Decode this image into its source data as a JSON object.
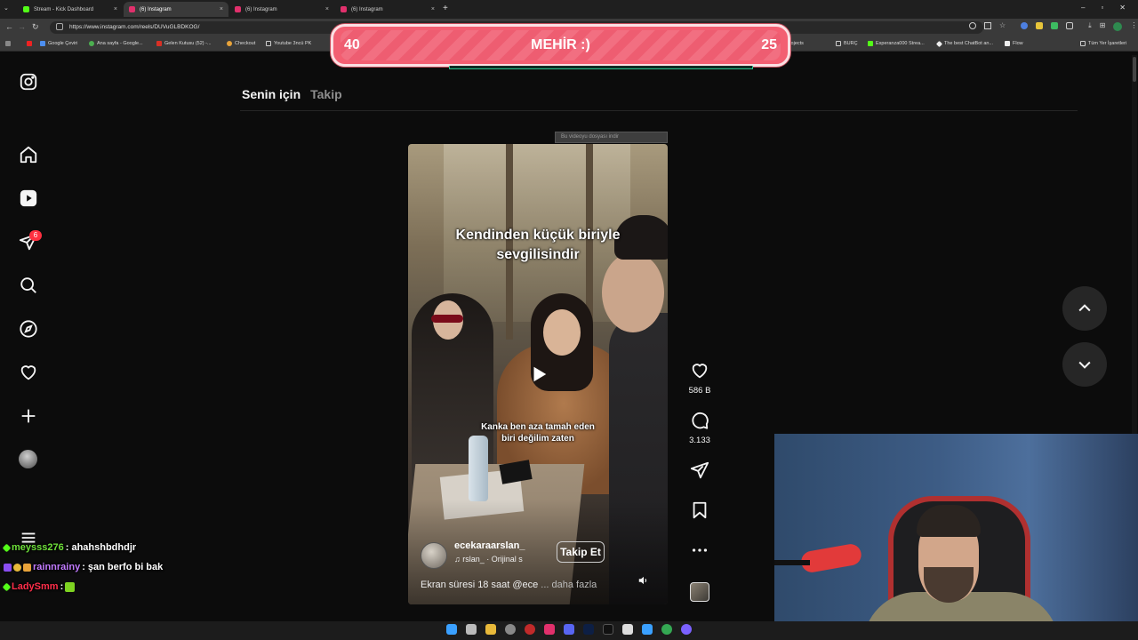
{
  "browser": {
    "tabs": [
      {
        "title": "Stream - Kick Dashboard",
        "favicon_color": "#53fc18",
        "active": false
      },
      {
        "title": "(6) Instagram",
        "favicon_color": "#e1306c",
        "active": true
      },
      {
        "title": "(6) Instagram",
        "favicon_color": "#e1306c",
        "active": false
      },
      {
        "title": "(6) Instagram",
        "favicon_color": "#e1306c",
        "active": false
      }
    ],
    "tab_close": "×",
    "new_tab": "+",
    "url": "https://www.instagram.com/reels/DUVuGLBDKOG/",
    "bookmarks": [
      "Google Çeviri",
      "Ana sayfa - Google...",
      "Gelen Kutusu (52) -...",
      "Checkout",
      "Youtube 3ncü PK",
      "yGen - Projects",
      "BURÇ",
      "Esperanza000 Strea...",
      "The best ChatBot an...",
      "Flow",
      "Tüm Yer İşaretleri"
    ]
  },
  "stream_banner": {
    "left_number": "40",
    "title": "MEHİR :)",
    "right_number": "25"
  },
  "sidebar": {
    "notification_count": "6"
  },
  "feed_tabs": {
    "for_you": "Senin için",
    "following": "Takip"
  },
  "download_banner": "Bu videoyu dosyası indir",
  "reel": {
    "caption_line1": "Kendinden küçük biriyle",
    "caption_line2": "sevgilisindir",
    "subtitle_line1": "Kanka ben aza tamah eden",
    "subtitle_line2": "biri değilim zaten",
    "username": "ecekaraarslan_",
    "audio": "rslan_ · Orijinal s",
    "follow_label": "Takip Et",
    "description": "Ekran süresi 18 saat @ece",
    "more_label": "... daha fazla"
  },
  "actions": {
    "likes": "586 B",
    "comments": "3.133"
  },
  "chat": [
    {
      "user": "meysss276",
      "message": ": ahahshbdhdjr",
      "user_color": "#6ee03a"
    },
    {
      "user": "rainnrainy",
      "message": ": şan berfo bi bak",
      "user_color": "#c27bff"
    },
    {
      "user": "LadySmm",
      "message": ": ",
      "user_color": "#ff2e4a"
    }
  ],
  "colors": {
    "accent_pink": "#f35f72",
    "instagram_badge": "#ff3040",
    "kick_green": "#53fc18"
  }
}
